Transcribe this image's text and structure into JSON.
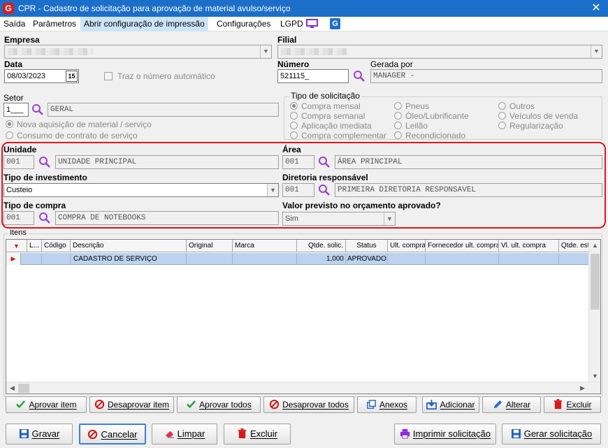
{
  "window": {
    "title": "CPR - Cadastro de solicitação para aprovação de material avulso/serviço",
    "app_icon": "G",
    "close": "✕"
  },
  "menu": {
    "items": [
      "Saída",
      "Parâmetros",
      "Abrir configuração de impressão",
      "Configurações",
      "LGPD"
    ],
    "active_index": 2
  },
  "form": {
    "empresa_label": "Empresa",
    "filial_label": "Filial",
    "data_label": "Data",
    "data_value": "08/03/2023",
    "traz_label": "Traz o número automático",
    "numero_label": "Número",
    "numero_value": "521115_",
    "gerada_label": "Gerada por",
    "gerada_value": "MANAGER -",
    "setor_label": "Setor",
    "setor_code": "1___",
    "setor_name": "GERAL",
    "nova_aquisicao": "Nova aquisição de material / serviço",
    "consumo_contrato": "Consumo de contrato de serviço"
  },
  "tipo_solicitacao": {
    "label": "Tipo de solicitação",
    "options": [
      "Compra mensal",
      "Compra semanal",
      "Aplicação imediata",
      "Compra complementar",
      "Pneus",
      "Óleo/Lubrificante",
      "Leilão",
      "Recondicionado",
      "Outros",
      "Veículos de venda",
      "Regularização"
    ],
    "selected": "Compra mensal"
  },
  "highlight": {
    "unidade_label": "Unidade",
    "unidade_code": "001",
    "unidade_name": "UNIDADE PRINCIPAL",
    "area_label": "Área",
    "area_code": "001",
    "area_name": "ÁREA PRINCIPAL",
    "tipo_investimento_label": "Tipo de investimento",
    "tipo_investimento_value": "Custeio",
    "diretoria_label": "Diretoria responsável",
    "diretoria_code": "001",
    "diretoria_name": "PRIMEIRA DIRETORIA RESPONSAVEL",
    "tipo_compra_label": "Tipo de compra",
    "tipo_compra_code": "001",
    "tipo_compra_name": "COMPRA DE NOTEBOOKS",
    "valor_previsto_label": "Valor previsto no orçamento aprovado?",
    "valor_previsto_value": "Sim"
  },
  "itens": {
    "label": "Itens",
    "columns": [
      "L...",
      "Código",
      "Descrição",
      "Original",
      "Marca",
      "Qtde. solic.",
      "Status",
      "Ult. compra",
      "Fornecedor ult. compra",
      "Vl. ult. compra",
      "Qtde. est."
    ],
    "rows": [
      {
        "l": "",
        "codigo": "",
        "descricao": "CADASTRO DE SERVIÇO",
        "original": "",
        "marca": "",
        "qtde": "1,000",
        "status": "APROVADO",
        "ult": "",
        "fornecedor": "",
        "vl": "",
        "est": ""
      }
    ]
  },
  "item_buttons": [
    "Aprovar item",
    "Desaprovar item",
    "Aprovar todos",
    "Desaprovar todos",
    "Anexos",
    "Adicionar",
    "Alterar",
    "Excluir"
  ],
  "main_buttons": [
    "Gravar",
    "Cancelar",
    "Limpar",
    "Excluir",
    "Imprimir solicitação",
    "Gerar solicitação"
  ],
  "colors": {
    "title_bar": "#1c6fc9",
    "highlight": "#e0151c",
    "selected_row": "#bcd2ee",
    "search_icon": "#9b3fd0"
  }
}
